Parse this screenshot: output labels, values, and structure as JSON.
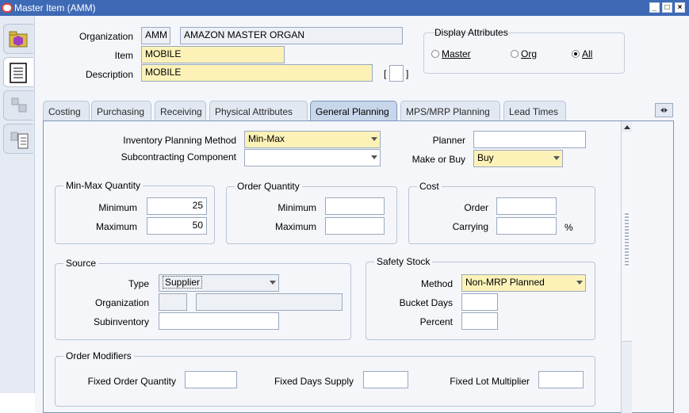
{
  "window": {
    "title": "Master Item (AMM)",
    "min": "_",
    "max": "□",
    "close": "×"
  },
  "header": {
    "org_label": "Organization",
    "org_code": "AMM",
    "org_name": "AMAZON MASTER ORGAN",
    "item_label": "Item",
    "item_value": "MOBILE",
    "desc_label": "Description",
    "desc_value": "MOBILE",
    "bracket_open": "[",
    "bracket_close": "]"
  },
  "display_attributes": {
    "title": "Display Attributes",
    "options": [
      {
        "label": "Master",
        "selected": false
      },
      {
        "label": "Org",
        "selected": false
      },
      {
        "label": "All",
        "selected": true
      }
    ]
  },
  "tabs": [
    {
      "label": "Costing",
      "active": false
    },
    {
      "label": "Purchasing",
      "active": false
    },
    {
      "label": "Receiving",
      "active": false
    },
    {
      "label": "Physical Attributes",
      "active": false
    },
    {
      "label": "General Planning",
      "active": true
    },
    {
      "label": "MPS/MRP Planning",
      "active": false
    },
    {
      "label": "Lead Times",
      "active": false
    }
  ],
  "planning": {
    "inv_method_label": "Inventory Planning Method",
    "inv_method_value": "Min-Max",
    "subcontract_label": "Subcontracting Component",
    "subcontract_value": "",
    "planner_label": "Planner",
    "planner_value": "",
    "make_buy_label": "Make or Buy",
    "make_buy_value": "Buy"
  },
  "minmax": {
    "title": "Min-Max Quantity",
    "min_label": "Minimum",
    "min_value": "25",
    "max_label": "Maximum",
    "max_value": "50"
  },
  "order_qty": {
    "title": "Order Quantity",
    "min_label": "Minimum",
    "min_value": "",
    "max_label": "Maximum",
    "max_value": ""
  },
  "cost": {
    "title": "Cost",
    "order_label": "Order",
    "order_value": "",
    "carrying_label": "Carrying",
    "carrying_value": "",
    "pct": "%"
  },
  "source": {
    "title": "Source",
    "type_label": "Type",
    "type_value": "Supplier",
    "org_label": "Organization",
    "org_value": "",
    "org_name_value": "",
    "subinv_label": "Subinventory",
    "subinv_value": ""
  },
  "safety": {
    "title": "Safety Stock",
    "method_label": "Method",
    "method_value": "Non-MRP Planned",
    "bucket_label": "Bucket Days",
    "bucket_value": "",
    "percent_label": "Percent",
    "percent_value": ""
  },
  "modifiers": {
    "title": "Order Modifiers",
    "foq_label": "Fixed Order Quantity",
    "foq_value": "",
    "fds_label": "Fixed Days Supply",
    "fds_value": "",
    "flm_label": "Fixed Lot Multiplier",
    "flm_value": ""
  },
  "colors": {
    "title_bar": "#3e6ab5",
    "required": "#fcf2b8",
    "active_tab": "#c7d6ea"
  }
}
